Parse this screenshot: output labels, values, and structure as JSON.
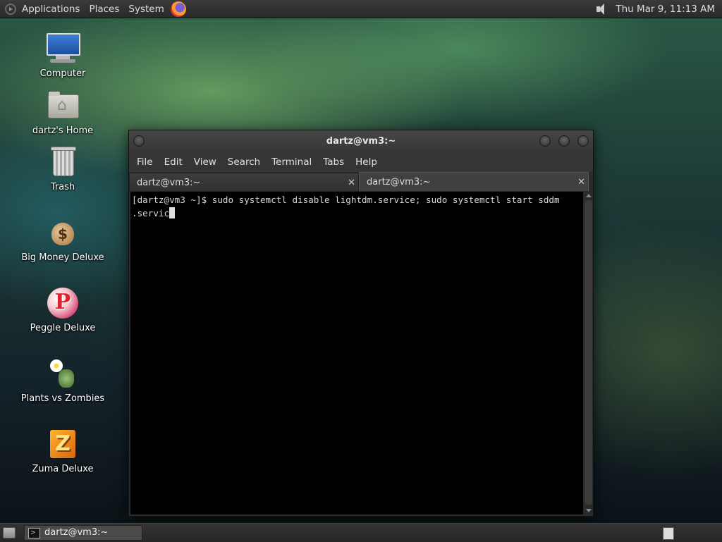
{
  "top_panel": {
    "menus": [
      "Applications",
      "Places",
      "System"
    ],
    "clock": "Thu Mar  9, 11:13 AM",
    "icons": [
      "menu-logo-icon",
      "firefox-icon",
      "speaker-icon"
    ]
  },
  "desktop": {
    "icons": [
      {
        "label": "Computer",
        "icon": "computer-icon"
      },
      {
        "label": "dartz's Home",
        "icon": "home-folder-icon"
      },
      {
        "label": "Trash",
        "icon": "trash-icon"
      },
      {
        "label": "Big Money Deluxe",
        "icon": "money-bag-icon"
      },
      {
        "label": "Peggle Deluxe",
        "icon": "peggle-icon"
      },
      {
        "label": "Plants vs Zombies",
        "icon": "plants-vs-zombies-icon"
      },
      {
        "label": "Zuma Deluxe",
        "icon": "zuma-icon"
      }
    ]
  },
  "terminal": {
    "title": "dartz@vm3:~",
    "menus": [
      "File",
      "Edit",
      "View",
      "Search",
      "Terminal",
      "Tabs",
      "Help"
    ],
    "tabs": [
      {
        "label": "dartz@vm3:~",
        "active": false
      },
      {
        "label": "dartz@vm3:~",
        "active": true
      }
    ],
    "close_glyph": "✕",
    "lines": [
      "[dartz@vm3 ~]$ sudo systemctl disable lightdm.service; sudo systemctl start sddm",
      ".servic"
    ]
  },
  "bottom_panel": {
    "task": "dartz@vm3:~"
  },
  "colors": {
    "panel": "#2e2e2e",
    "terminal_bg": "#000000",
    "terminal_fg": "#d6d6d6"
  }
}
